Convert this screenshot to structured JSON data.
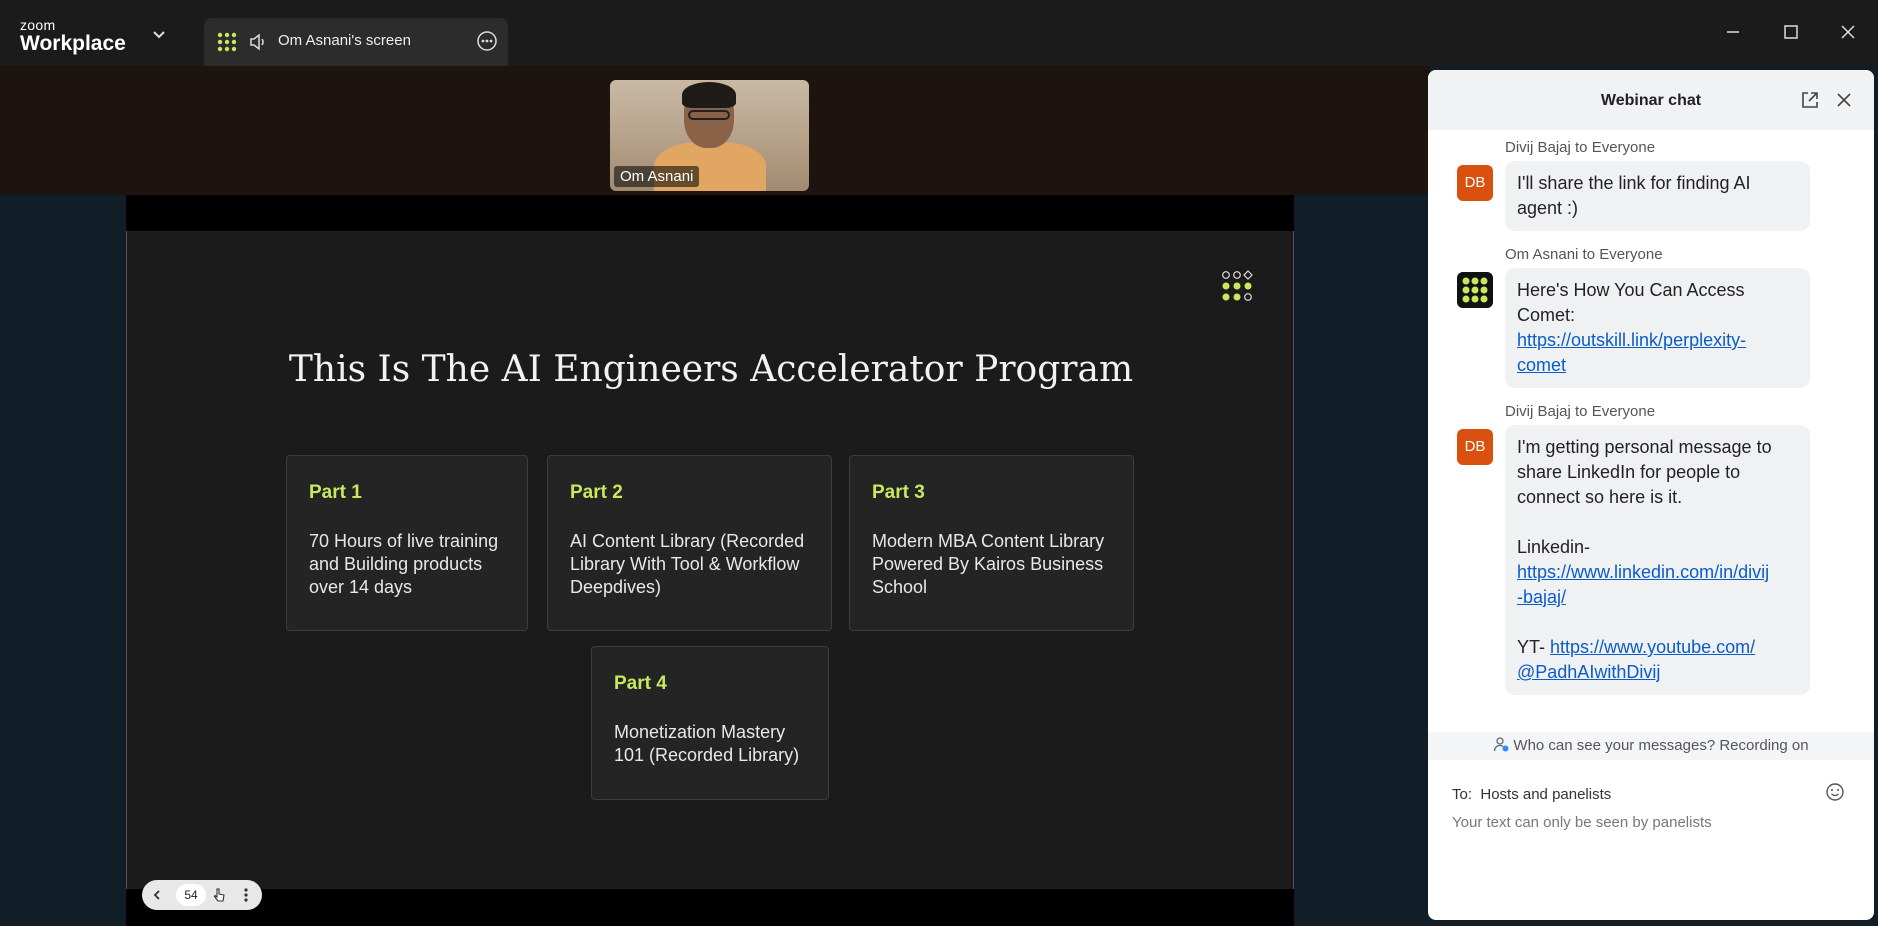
{
  "app": {
    "brand_small": "zoom",
    "brand_big": "Workplace"
  },
  "share_tab": {
    "label": "Om Asnani's screen"
  },
  "video": {
    "participant_name": "Om Asnani"
  },
  "slide": {
    "title": "This Is The AI Engineers Accelerator Program",
    "accent_color": "#c7e95b",
    "cards": [
      {
        "part": "Part 1",
        "description": "70 Hours of live training and Building products over 14 days"
      },
      {
        "part": "Part 2",
        "description": "AI Content Library (Recorded Library With Tool & Workflow Deepdives)"
      },
      {
        "part": "Part 3",
        "description": "Modern MBA Content Library Powered By Kairos Business School"
      },
      {
        "part": "Part 4",
        "description": "Monetization Mastery 101 (Recorded Library)"
      }
    ],
    "page_number": "54"
  },
  "chat": {
    "title": "Webinar chat",
    "messages": [
      {
        "sender": "Divij Bajaj to Everyone",
        "avatar": "DB",
        "lines": [
          "I'll share the link for finding AI",
          "agent :)"
        ]
      },
      {
        "sender": "Om Asnani to Everyone",
        "avatar": "",
        "text_lines": [
          "Here's How You Can Access",
          "Comet:"
        ],
        "link_lines": [
          "https://outskill.link/perplexity-",
          "comet"
        ]
      },
      {
        "sender": "Divij Bajaj to Everyone",
        "avatar": "DB",
        "text_lines": [
          "I'm getting personal message to",
          "share LinkedIn for people to",
          "connect so here is it."
        ],
        "linkedin_label": "Linkedin-",
        "linkedin_lines": [
          "https://www.linkedin.com/in/divij",
          "-bajaj/"
        ],
        "yt_label": "YT-",
        "yt_lines": [
          "https://www.youtube.com/",
          "@PadhAIwithDivij"
        ]
      }
    ],
    "notice": "Who can see your messages? Recording on",
    "to_prefix": "To:",
    "to_value": "Hosts and panelists",
    "input_placeholder": "Your text can only be seen by panelists"
  }
}
